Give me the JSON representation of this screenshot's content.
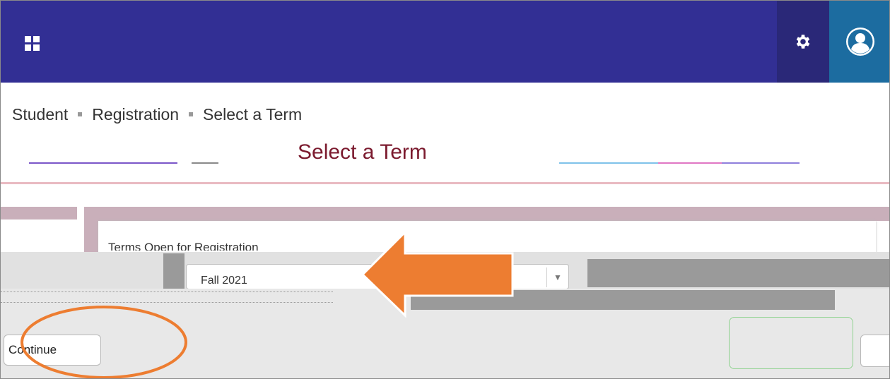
{
  "header": {
    "apps_icon": "apps-grid-icon",
    "settings_icon": "gear-icon",
    "user_icon": "user-avatar-icon",
    "bar_color": "#322f94"
  },
  "breadcrumb": {
    "items": [
      "Student",
      "Registration",
      "Select a Term"
    ]
  },
  "page": {
    "title": "Select a Term",
    "title_color": "#7b1a2e"
  },
  "form": {
    "terms_label": "Terms Open for Registration",
    "selected_term": "Fall 2021",
    "continue_label": "Continue"
  },
  "annotations": {
    "arrow_color": "#ed7d31",
    "circle_color": "#ed7d31"
  }
}
